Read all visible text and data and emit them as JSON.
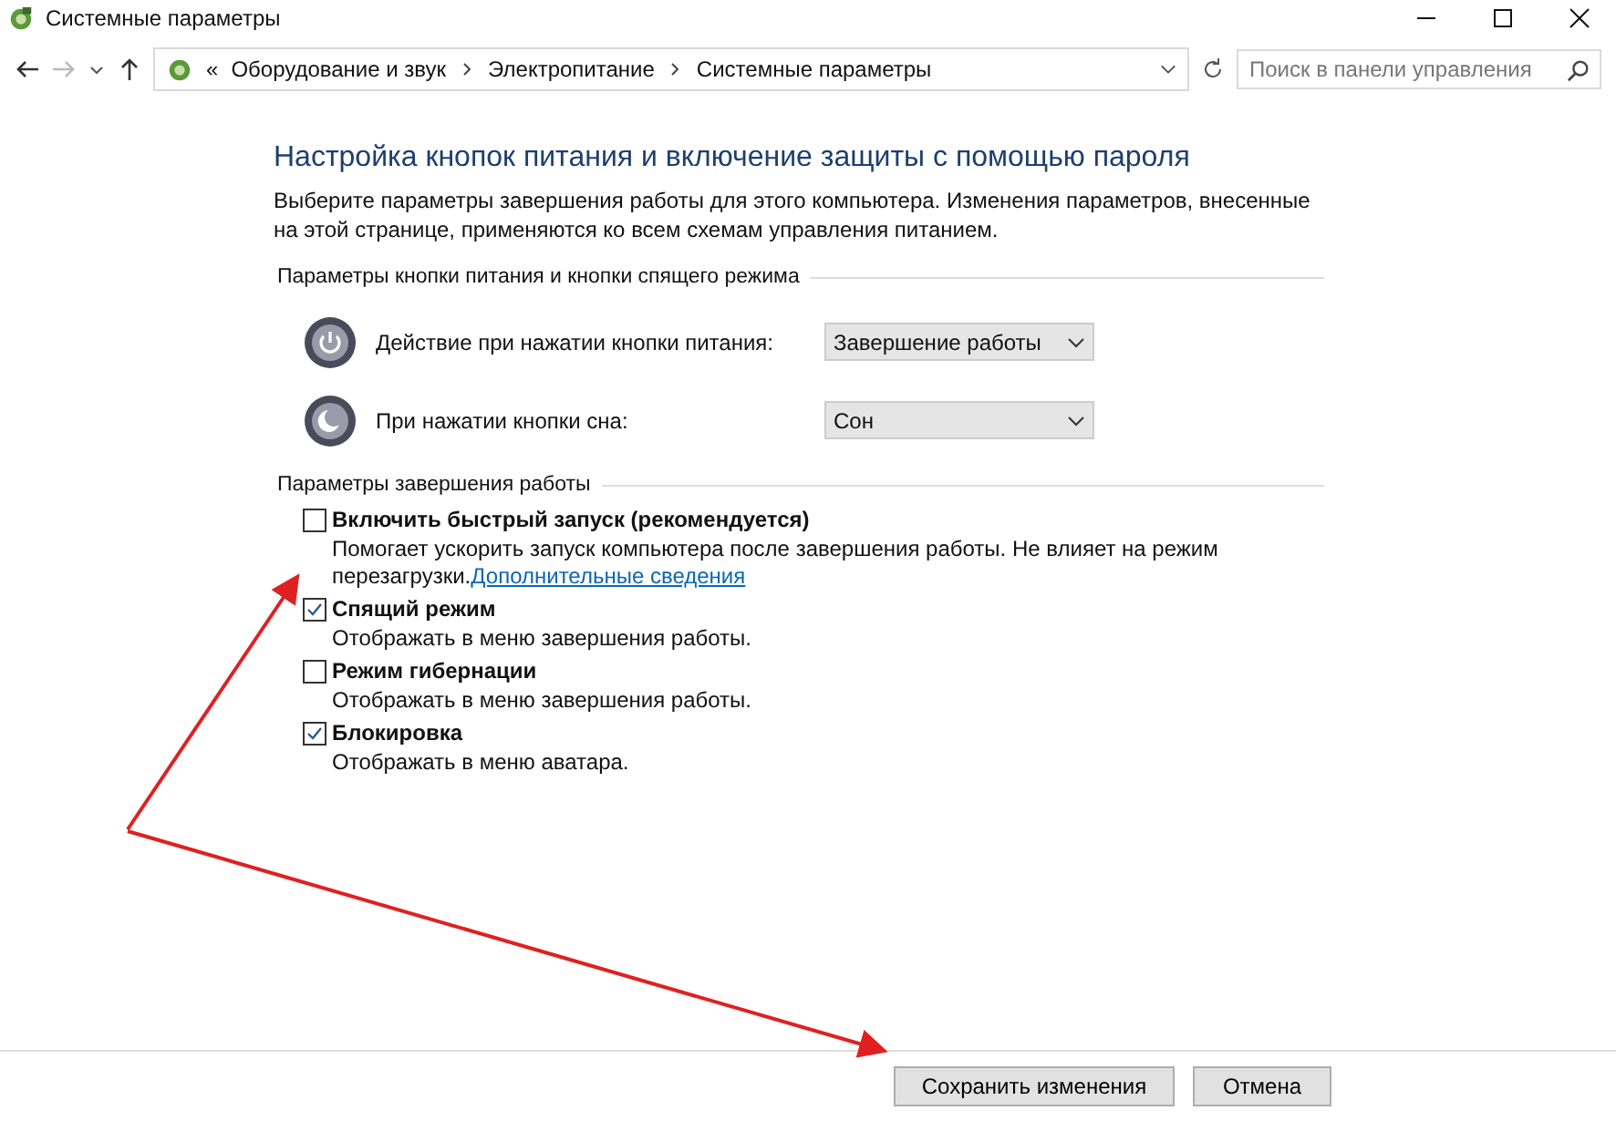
{
  "window": {
    "title": "Системные параметры"
  },
  "address_bar": {
    "prefix": "«",
    "crumbs": [
      "Оборудование и звук",
      "Электропитание",
      "Системные параметры"
    ]
  },
  "search": {
    "placeholder": "Поиск в панели управления"
  },
  "heading": "Настройка кнопок питания и включение защиты с помощью пароля",
  "intro": "Выберите параметры завершения работы для этого компьютера. Изменения параметров, внесенные на этой странице, применяются ко всем схемам управления питанием.",
  "buttons_section": {
    "title": "Параметры кнопки питания и кнопки спящего режима",
    "rows": [
      {
        "kind": "power",
        "label": "Действие при нажатии кнопки питания:",
        "value": "Завершение работы"
      },
      {
        "kind": "sleep",
        "label": "При нажатии кнопки сна:",
        "value": "Сон"
      }
    ]
  },
  "shutdown_section": {
    "title": "Параметры завершения работы",
    "options": [
      {
        "label": "Включить быстрый запуск (рекомендуется)",
        "checked": false,
        "description": "Помогает ускорить запуск компьютера после завершения работы. Не влияет на режим перезагрузки.",
        "link": "Дополнительные сведения"
      },
      {
        "label": "Спящий режим",
        "checked": true,
        "description": "Отображать в меню завершения работы."
      },
      {
        "label": "Режим гибернации",
        "checked": false,
        "description": "Отображать в меню завершения работы."
      },
      {
        "label": "Блокировка",
        "checked": true,
        "description": "Отображать в меню аватара."
      }
    ]
  },
  "footer_buttons": [
    "Сохранить изменения",
    "Отмена"
  ]
}
